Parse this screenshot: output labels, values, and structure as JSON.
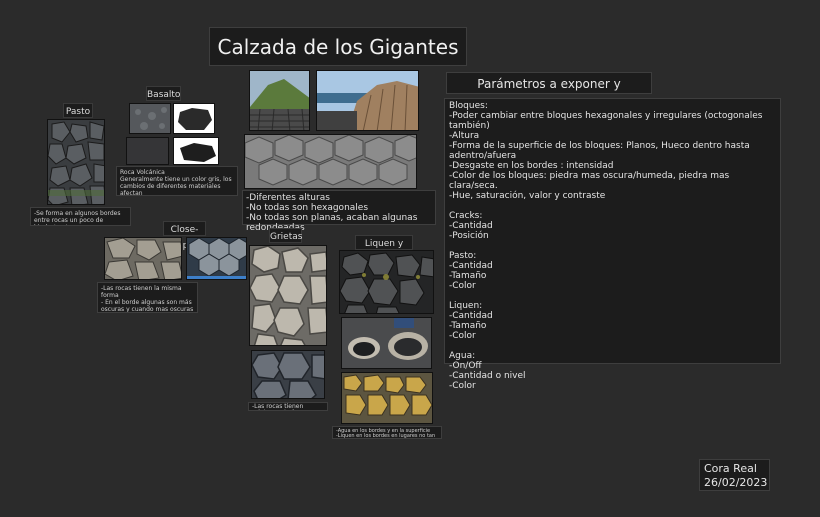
{
  "board": {
    "title": "Calzada de los Gigantes",
    "sections": {
      "pasto": "Pasto",
      "basalto": "Basalto",
      "closeups": "Close-Ups",
      "grietas": "Grietas",
      "liquen": "Liquen y agua"
    },
    "notes": {
      "pasto": "-Se forma en algunos bordes entre rocas un poco de hierba/pasto",
      "basalto": "Roca Volcánica\nGeneralmente tiene un color gris, los cambios de diferentes materiales afectan\n-Superficie rugosa",
      "alturas": "-Diferentes alturas\n-No todas son hexagonales\n-No todas son planas, acaban algunas redondeadas",
      "closeups": "-Las rocas tienen la misma forma\n- En el borde algunas son más oscuras y cuando mas oscuras se ve la humedad\n-Las bases del de otras son diferentes",
      "grietas": "-Las rocas tienen grietas en toda su superficie",
      "liquen": "-Agua en los bordes y en la superficie\n-Liquen en los bordes en lugares no tan vistos"
    },
    "params": {
      "title": "Parámetros a exponer y componentes",
      "body": "Bloques:\n-Poder cambiar entre bloques hexagonales y irregulares (octogonales también)\n-Altura\n-Forma de la superficie de los bloques: Planos, Hueco dentro hasta adentro/afuera\n-Desgaste en los bordes : intensidad\n-Color de los bloques: piedra mas oscura/humeda, piedra mas clara/seca.\n-Hue, saturación, valor y contraste\n\nCracks:\n-Cantidad\n-Posición\n\nPasto:\n-Cantidad\n-Tamaño\n-Color\n\nLiquen:\n-Cantidad\n-Tamaño\n-Color\n\nAgua:\n-On/Off\n-Cantidad o nivel\n-Color"
    },
    "author": {
      "name": "Cora Real",
      "date": "26/02/2023"
    }
  }
}
